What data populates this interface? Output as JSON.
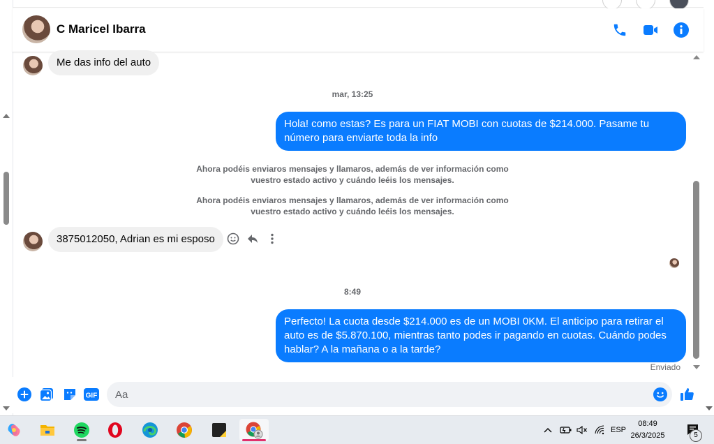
{
  "contact": {
    "name": "C Maricel Ibarra"
  },
  "header_icons": [
    "phone-icon",
    "video-camera-icon",
    "info-icon"
  ],
  "messages": {
    "m1": {
      "text": "Me das info del auto",
      "direction": "incoming"
    },
    "ts1": "mar, 13:25",
    "m2": {
      "text": "Hola! como estas? Es para un FIAT MOBI con cuotas de $214.000. Pasame tu número para enviarte toda la info",
      "direction": "outgoing"
    },
    "sys1": "Ahora podéis enviaros mensajes y llamaros, además de ver información como vuestro estado activo y cuándo leéis los mensajes.",
    "sys2": "Ahora podéis enviaros mensajes y llamaros, además de ver información como vuestro estado activo y cuándo leéis los mensajes.",
    "m3": {
      "text": "3875012050, Adrian es mi esposo",
      "direction": "incoming"
    },
    "ts2": "8:49",
    "m4": {
      "text": "Perfecto! La cuota desde $214.000 es de un MOBI 0KM. El anticipo para retirar el auto es de $5.870.100, mientras tanto podes ir pagando en cuotas. Cuándo podes hablar? A la mañana o a la tarde?",
      "direction": "outgoing"
    },
    "status": "Enviado"
  },
  "composer": {
    "placeholder": "Aa"
  },
  "colors": {
    "accent": "#0a7cff",
    "incoming_bubble": "#f0f0f0",
    "text_secondary": "#65676b"
  },
  "taskbar": {
    "apps": [
      "copilot-icon",
      "file-explorer-icon",
      "spotify-icon",
      "opera-icon",
      "edge-icon",
      "chrome-icon",
      "sticky-notes-icon",
      "chrome-profile-icon"
    ],
    "tray": {
      "language": "ESP",
      "time": "08:49",
      "date": "26/3/2025",
      "notifications": "5"
    }
  }
}
